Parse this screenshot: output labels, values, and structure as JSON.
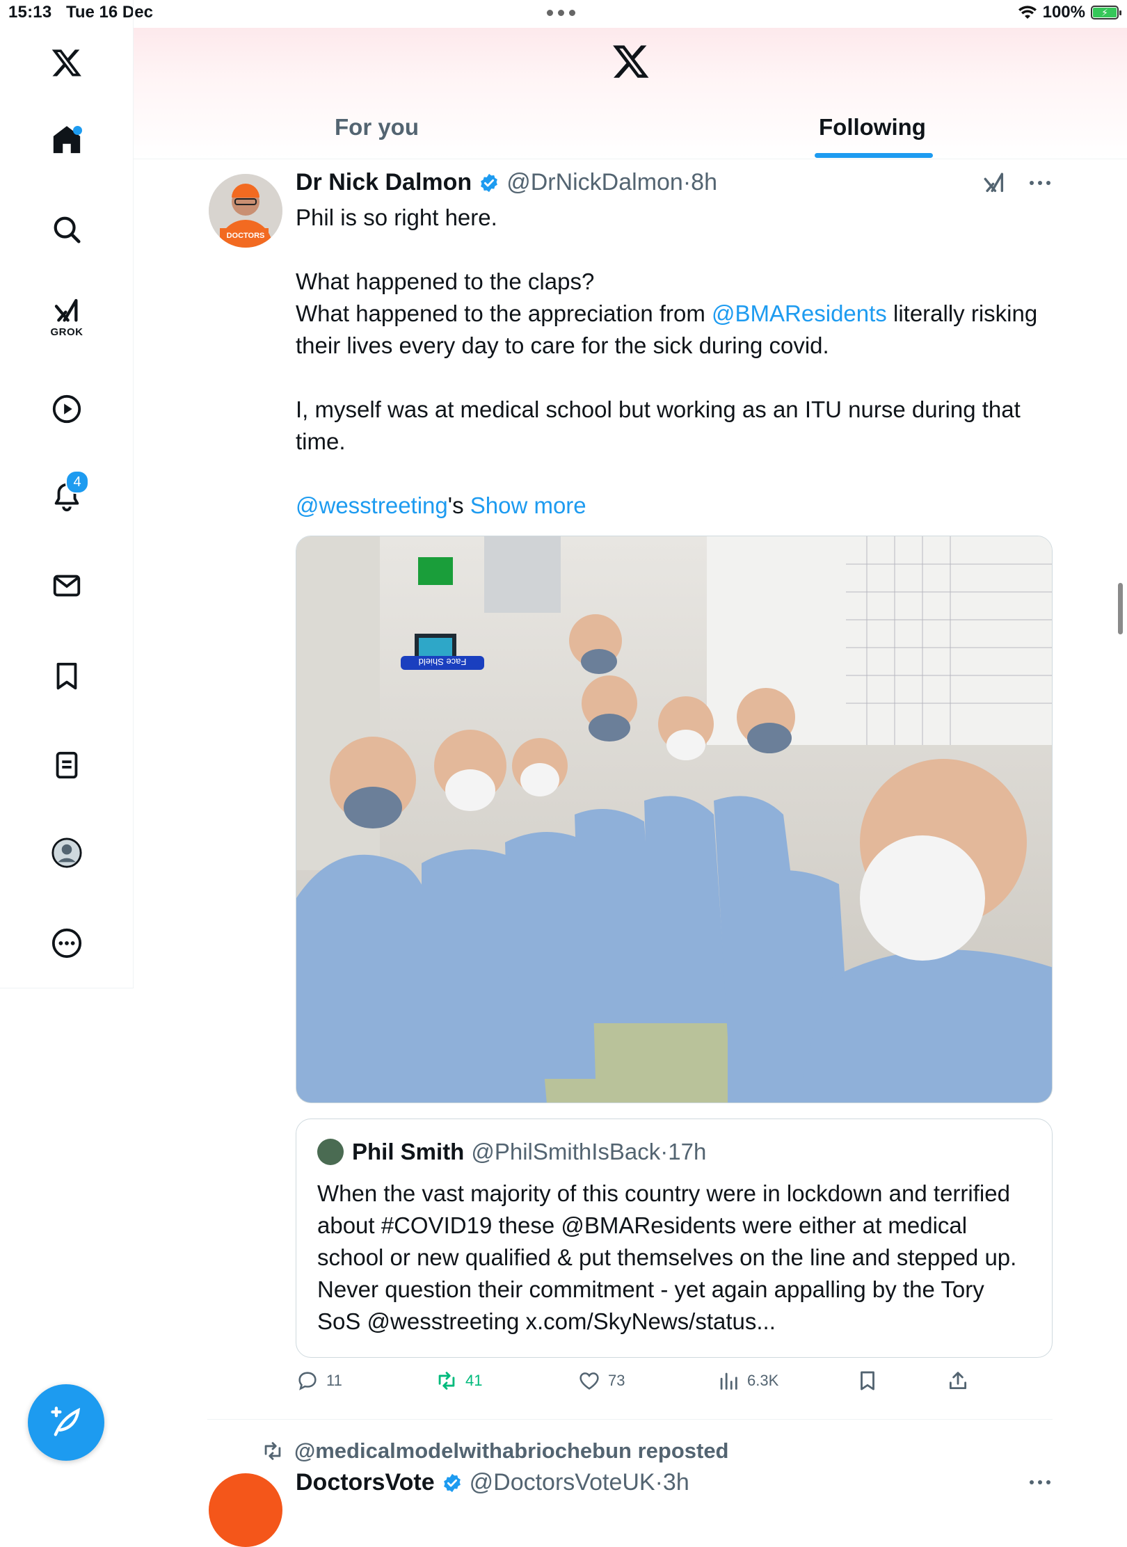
{
  "status_bar": {
    "time": "15:13",
    "date": "Tue 16 Dec",
    "battery": "100%"
  },
  "sidebar": {
    "items": [
      {
        "name": "home",
        "has_dot": true
      },
      {
        "name": "search"
      },
      {
        "name": "grok",
        "label": "GROK"
      },
      {
        "name": "video"
      },
      {
        "name": "notifications",
        "badge": "4"
      },
      {
        "name": "messages"
      },
      {
        "name": "bookmarks"
      },
      {
        "name": "lists"
      },
      {
        "name": "profile"
      },
      {
        "name": "more"
      }
    ]
  },
  "header": {
    "tabs": [
      {
        "label": "For you",
        "active": false
      },
      {
        "label": "Following",
        "active": true
      }
    ]
  },
  "tweet": {
    "author_name": "Dr Nick Dalmon",
    "handle": "@DrNickDalmon",
    "time": "8h",
    "avatar_text": "DOCTORS",
    "line1": "Phil is so right here.",
    "line2": "What happened to the claps?",
    "line3_pre": "What happened to the appreciation from ",
    "line3_mention": "@BMAResidents",
    "line3_post": " literally risking their lives every day to care for the sick during covid.",
    "line4": "I, myself was at medical school but working as an ITU nurse during that time.",
    "line5_mention": "@wesstreeting",
    "line5_post": "'s",
    "show_more": "Show more",
    "photo_text": "Face Shield",
    "quote": {
      "author_name": "Phil Smith",
      "handle": "@PhilSmithIsBack",
      "time": "17h",
      "text": "When the vast majority of this country were in lockdown and terrified about #COVID19 these @BMAResidents were either at medical school or new qualified & put themselves on the line and stepped up. Never question their commitment - yet again appalling by the Tory SoS @wesstreeting x.com/SkyNews/status..."
    },
    "actions": {
      "replies": "11",
      "reposts": "41",
      "likes": "73",
      "views": "6.3K"
    }
  },
  "next_tweet": {
    "repost_text": "@medicalmodelwithabriochebun reposted",
    "author_name": "DoctorsVote",
    "handle": "@DoctorsVoteUK",
    "time": "3h"
  },
  "colors": {
    "accent": "#1d9bf0",
    "retweet": "#00ba7c",
    "muted": "#536471",
    "text": "#0f1419"
  }
}
